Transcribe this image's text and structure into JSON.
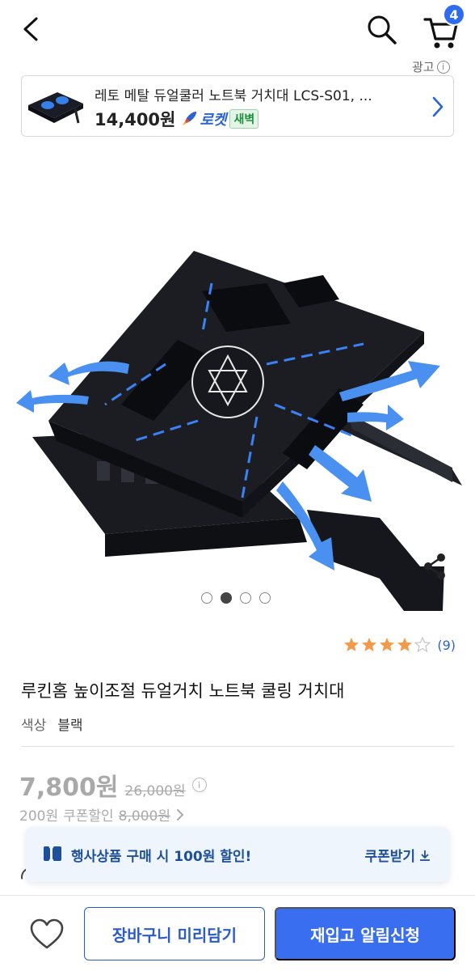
{
  "header": {
    "cart_count": "4"
  },
  "ad": {
    "label": "광고",
    "title": "레토 메탈 듀얼쿨러 노트북 거치대 LCS-S01, ...",
    "price": "14,400원",
    "rocket_name": "로켓",
    "rocket_tag": "새벽"
  },
  "carousel": {
    "total": 4,
    "active_index": 1
  },
  "rating": {
    "stars": 4,
    "count": "(9)"
  },
  "product": {
    "title": "루킨홈 높이조절 듀얼거치 노트북 쿨링 거치대",
    "option_key": "색상",
    "option_value": "블랙"
  },
  "price": {
    "sale": "7,800원",
    "original": "26,000원",
    "coupon_amount": "200원",
    "coupon_label": "쿠폰할인",
    "coupon_price": "8,000원"
  },
  "promo": {
    "text": "행사상품 구매 시 100원 할인!",
    "action": "쿠폰받기"
  },
  "bottom": {
    "cart_add": "장바구니 미리담기",
    "restock": "재입고 알림신청"
  },
  "colors": {
    "accent": "#3a6ef0",
    "rocket": "#2a63d8",
    "promo_text": "#1e4f9a",
    "star": "#f29a4a"
  },
  "icons": [
    "back-arrow-icon",
    "search-icon",
    "cart-icon",
    "share-icon",
    "heart-icon",
    "chevron-right-icon",
    "info-icon",
    "coupon-icon",
    "download-icon"
  ]
}
